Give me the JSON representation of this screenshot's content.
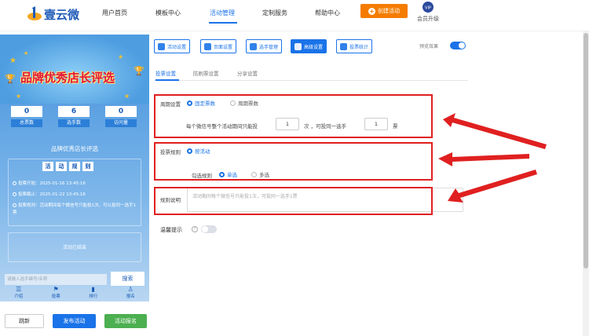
{
  "header": {
    "brand": "壹云微",
    "nav": [
      "用户首页",
      "模板中心",
      "活动管理",
      "定制服务",
      "帮助中心"
    ],
    "active_nav": "活动管理",
    "create_button": "创建活动",
    "vip_label": "会员升级",
    "accent_color": "#1a73e8",
    "create_color": "#f57c00"
  },
  "preview": {
    "banner_title": "品牌优秀店长评选",
    "stats": [
      {
        "value": "0",
        "label": "总票数"
      },
      {
        "value": "6",
        "label": "选手数"
      },
      {
        "value": "0",
        "label": "访问量"
      }
    ],
    "activity_name": "品牌优秀店长评选",
    "rules_tags": [
      "活",
      "动",
      "规",
      "则"
    ],
    "rules": [
      "投票开始：2025-01-16 13:45:16",
      "投票截止：2025-01-22 13:45:16",
      "投票规则：活动期间每个微信号只能投1次，可以投同一选手1票"
    ],
    "ended_text": "活动已结束",
    "search_placeholder": "请输入选手编号/名称",
    "search_button": "搜索",
    "tabs": [
      "介绍",
      "投票",
      "排行",
      "报名"
    ]
  },
  "footer_buttons": {
    "back": "跳新",
    "publish": "发布活动",
    "signup": "活动报名"
  },
  "toolbar": {
    "buttons": [
      "活动设置",
      "页面设置",
      "选手管理",
      "高级设置",
      "投票统计"
    ],
    "active": "高级设置",
    "preview_label": "预览效果",
    "preview_on": true
  },
  "subtabs": [
    "投票设置",
    "防刷票设置",
    "分享设置"
  ],
  "vote_settings": {
    "cycle_label": "周期设置",
    "cycle_options": [
      "固定票数",
      "周期票数"
    ],
    "cycle_selected": "固定票数",
    "vote_text_prefix": "每个微信号整个活动期间只能投",
    "vote_count": "1",
    "vote_text_mid": "次 ，可投同一选手",
    "vote_same": "1",
    "vote_text_suffix": "票",
    "rule_label": "投票规则",
    "rule_option": "按活动",
    "check_label": "勾选规则",
    "check_options": [
      "单选",
      "多选"
    ],
    "check_selected": "单选",
    "desc_label": "规则说明",
    "desc_placeholder": "活动期间每个微信号只能投1次，可投同一选手1票",
    "tip_label": "温馨提示",
    "tip_on": false
  }
}
